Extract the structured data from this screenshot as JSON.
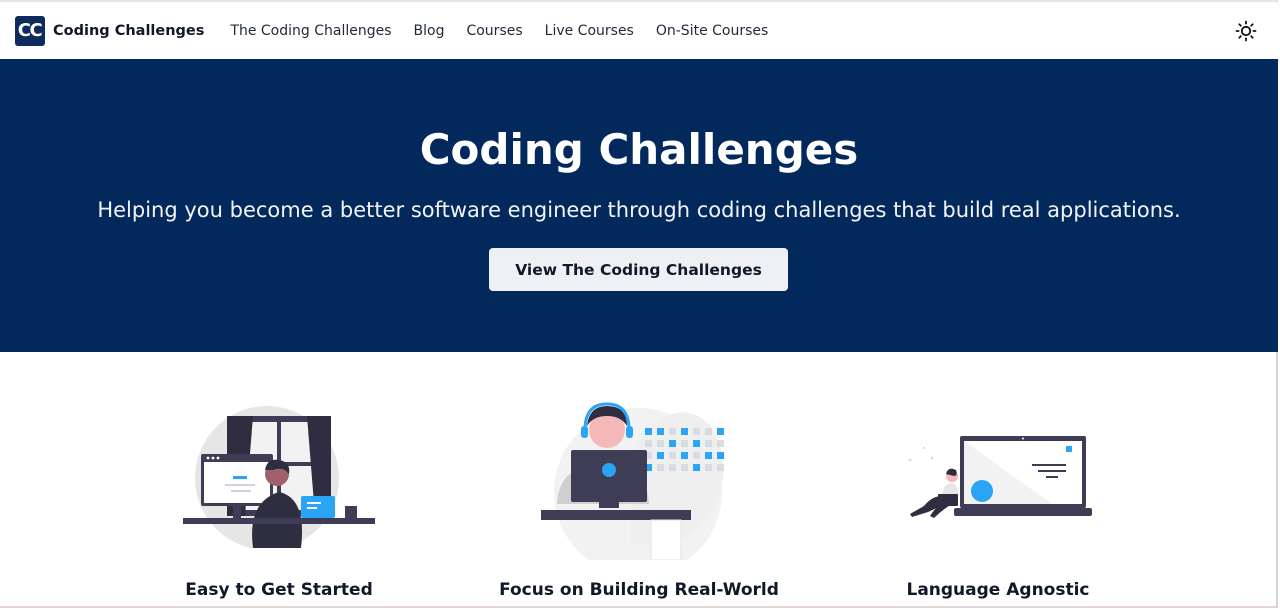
{
  "navbar": {
    "logo_text": "CC",
    "brand": "Coding Challenges",
    "links": [
      {
        "label": "The Coding Challenges"
      },
      {
        "label": "Blog"
      },
      {
        "label": "Courses"
      },
      {
        "label": "Live Courses"
      },
      {
        "label": "On-Site Courses"
      }
    ],
    "theme_icon": "sun-icon"
  },
  "hero": {
    "title": "Coding Challenges",
    "subtitle": "Helping you become a better software engineer through coding challenges that build real applications.",
    "button_label": "View The Coding Challenges"
  },
  "features": [
    {
      "title": "Easy to Get Started",
      "illustration": "developer-at-desk-illustration"
    },
    {
      "title": "Focus on Building Real-World",
      "illustration": "developer-with-headset-illustration"
    },
    {
      "title": "Language Agnostic",
      "illustration": "person-with-laptop-illustration"
    }
  ],
  "colors": {
    "hero_bg": "#03295c",
    "logo_bg": "#0d2b5c",
    "accent_blue": "#2aa4f4",
    "illustration_dark": "#3f3d56"
  }
}
